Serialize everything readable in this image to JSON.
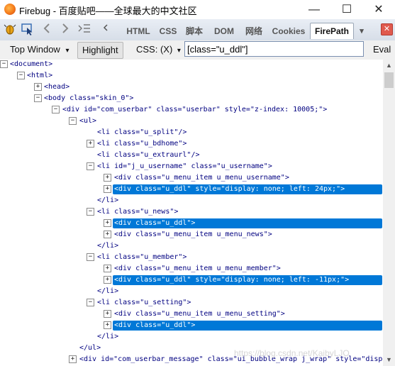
{
  "window": {
    "title": "Firebug - 百度贴吧——全球最大的中文社区",
    "min_glyph": "—",
    "max_glyph": "☐",
    "close_glyph": "✕"
  },
  "toolbar": {
    "tabs": [
      "HTML",
      "CSS",
      "脚本",
      "DOM",
      "网络",
      "Cookies",
      "FirePath"
    ],
    "active_tab": "FirePath",
    "dropdown_glyph": "▾",
    "close_glyph": "✕"
  },
  "cmdbar": {
    "top_window": "Top Window",
    "top_window_arrow": "▾",
    "highlight": "Highlight",
    "css_label": "CSS: (X)",
    "css_arrow": "▾",
    "xpath_value": "[class=\"u_ddl\"]",
    "eval": "Eval"
  },
  "tree": {
    "document": "<document>",
    "html": "<html>",
    "head": "<head>",
    "body": "<body class=\"skin_0\">",
    "userbar": "<div id=\"com_userbar\" class=\"userbar\" style=\"z-index: 10005;\">",
    "ul_open": "<ul>",
    "li_split": "<li class=\"u_split\"/>",
    "li_bdhome": "<li class=\"u_bdhome\">",
    "li_extraurl": "<li class=\"u_extraurl\"/>",
    "li_username": "<li id=\"j_u_username\" class=\"u_username\">",
    "div_menu_username": "<div class=\"u_menu_item u_menu_username\">",
    "div_ddl_1": "<div class=\"u_ddl\" style=\"display: none; left: 24px;\">",
    "li_close_1": "</li>",
    "li_news": "<li class=\"u_news\">",
    "div_ddl_2": "<div class=\"u_ddl\">",
    "div_menu_news": "<div class=\"u_menu_item u_menu_news\">",
    "li_close_2": "</li>",
    "li_member": "<li class=\"u_member\">",
    "div_menu_member": "<div class=\"u_menu_item u_menu_member\">",
    "div_ddl_3": "<div class=\"u_ddl\" style=\"display: none; left: -11px;\">",
    "li_close_3": "</li>",
    "li_setting": "<li class=\"u_setting\">",
    "div_menu_setting": "<div class=\"u_menu_item u_menu_setting\">",
    "div_ddl_4": "<div class=\"u_ddl\">",
    "li_close_4": "</li>",
    "ul_close": "</ul>",
    "div_message": "<div id=\"com_userbar_message\" class=\"ui_bubble_wrap j_wrap\" style=\"display:"
  },
  "watermark": "https://blog.csdn.net/KaibyLJO",
  "colors": {
    "selection": "#0078d7",
    "tag": "#000080",
    "attr_value": "#a02020"
  }
}
